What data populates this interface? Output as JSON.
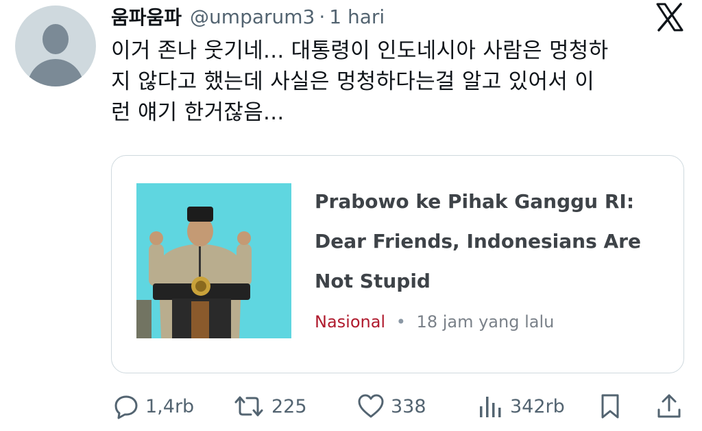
{
  "tweet": {
    "display_name": "움파움파",
    "handle": "@umparum3",
    "separator": "·",
    "time": "1 hari",
    "text_lines": [
      "이거 존나 웃기네... 대통령이 인도네시아 사람은 멍청하",
      "지 않다고 했는데 사실은 멍청하다는걸 알고 있어서 이",
      "런 얘기 한거잖음..."
    ]
  },
  "card": {
    "title_lines": [
      "Prabowo ke Pihak Ganggu RI:",
      "Dear Friends, Indonesians Are",
      "Not Stupid"
    ],
    "category": "Nasional",
    "separator": "•",
    "age": "18 jam yang lalu"
  },
  "actions": {
    "replies": "1,4rb",
    "reposts": "225",
    "likes": "338",
    "views": "342rb"
  },
  "icons": {
    "logo": "x-logo-icon",
    "reply": "reply-icon",
    "repost": "repost-icon",
    "like": "heart-icon",
    "views": "views-icon",
    "bookmark": "bookmark-icon",
    "share": "share-icon"
  },
  "colors": {
    "text": "#0f1419",
    "muted": "#536471",
    "category": "#b01b2e",
    "card_border": "#cfd9de",
    "thumb_background": "#5fd6e0"
  }
}
